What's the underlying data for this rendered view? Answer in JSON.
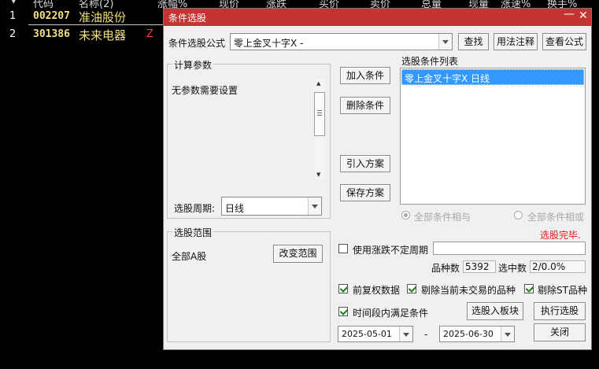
{
  "bg_table": {
    "headers": [
      "代码",
      "名称(2)",
      "涨幅%",
      "现价",
      "涨跌",
      "买价",
      "卖价",
      "总量",
      "现量",
      "涨速%",
      "换手%"
    ],
    "rows": [
      {
        "idx": "1",
        "code": "002207",
        "name": "准油股份",
        "flag": ""
      },
      {
        "idx": "2",
        "code": "301386",
        "name": "未来电器",
        "flag": "Z"
      }
    ]
  },
  "dialog": {
    "title": "条件选股",
    "formula_label": "条件选股公式",
    "formula_value": "零上金叉十字X -",
    "btn_find": "查找",
    "btn_usage": "用法注释",
    "btn_view": "查看公式",
    "params_group": "计算参数",
    "params_text": "无参数需要设置",
    "period_label": "选股周期:",
    "period_value": "日线",
    "btn_add": "加入条件",
    "btn_delete": "删除条件",
    "btn_import": "引入方案",
    "btn_save": "保存方案",
    "cond_list_label": "选股条件列表",
    "cond_items": [
      "零上金叉十字X  日线"
    ],
    "radio_and": "全部条件相与",
    "radio_or": "全部条件相或",
    "status": "选股完毕.",
    "range_group": "选股范围",
    "range_value": "全部A股",
    "btn_change_range": "改变范围",
    "chk_variable_period": "使用涨跌不定周期",
    "count_label": "品种数",
    "count_value": "5392",
    "selected_label": "选中数",
    "selected_value": "2/0.0%",
    "chk_fq": "前复权数据",
    "chk_remove_untraded": "剔除当前未交易的品种",
    "chk_remove_st": "剔除ST品种",
    "chk_time": "时间段内满足条件",
    "btn_to_block": "选股入板块",
    "btn_execute": "执行选股",
    "date_from": "2025-05-01",
    "date_sep": "-",
    "date_to": "2025-06-30",
    "btn_close": "关闭",
    "status_color": "#e02020",
    "title_color": "#c33433"
  }
}
